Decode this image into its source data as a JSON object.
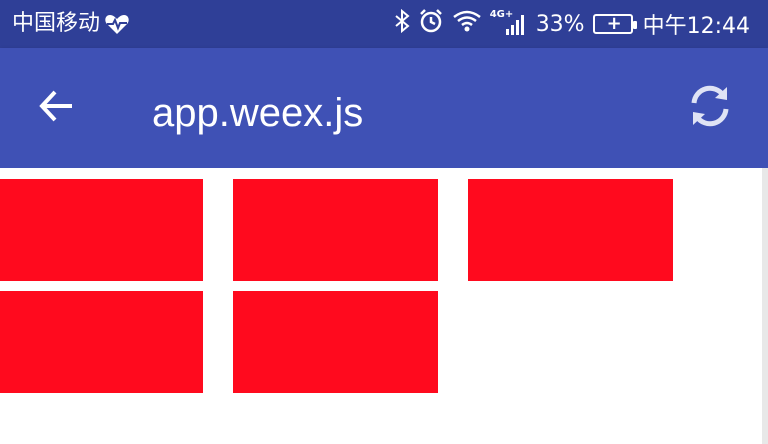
{
  "status_bar": {
    "carrier": "中国移动",
    "heart_icon": "heart-pulse-icon",
    "bluetooth_icon": "bluetooth-icon",
    "alarm_icon": "alarm-clock-icon",
    "wifi_icon": "wifi-icon",
    "network": "4G+",
    "battery_percent": "33%",
    "battery_icon": "battery-charging-icon",
    "time": "中午12:44"
  },
  "app_bar": {
    "back_icon": "arrow-back-icon",
    "title": "app.weex.js",
    "refresh_icon": "refresh-icon",
    "background": "#3f51b5"
  },
  "content": {
    "block_color": "#ff0a1e",
    "block_count": 5
  }
}
